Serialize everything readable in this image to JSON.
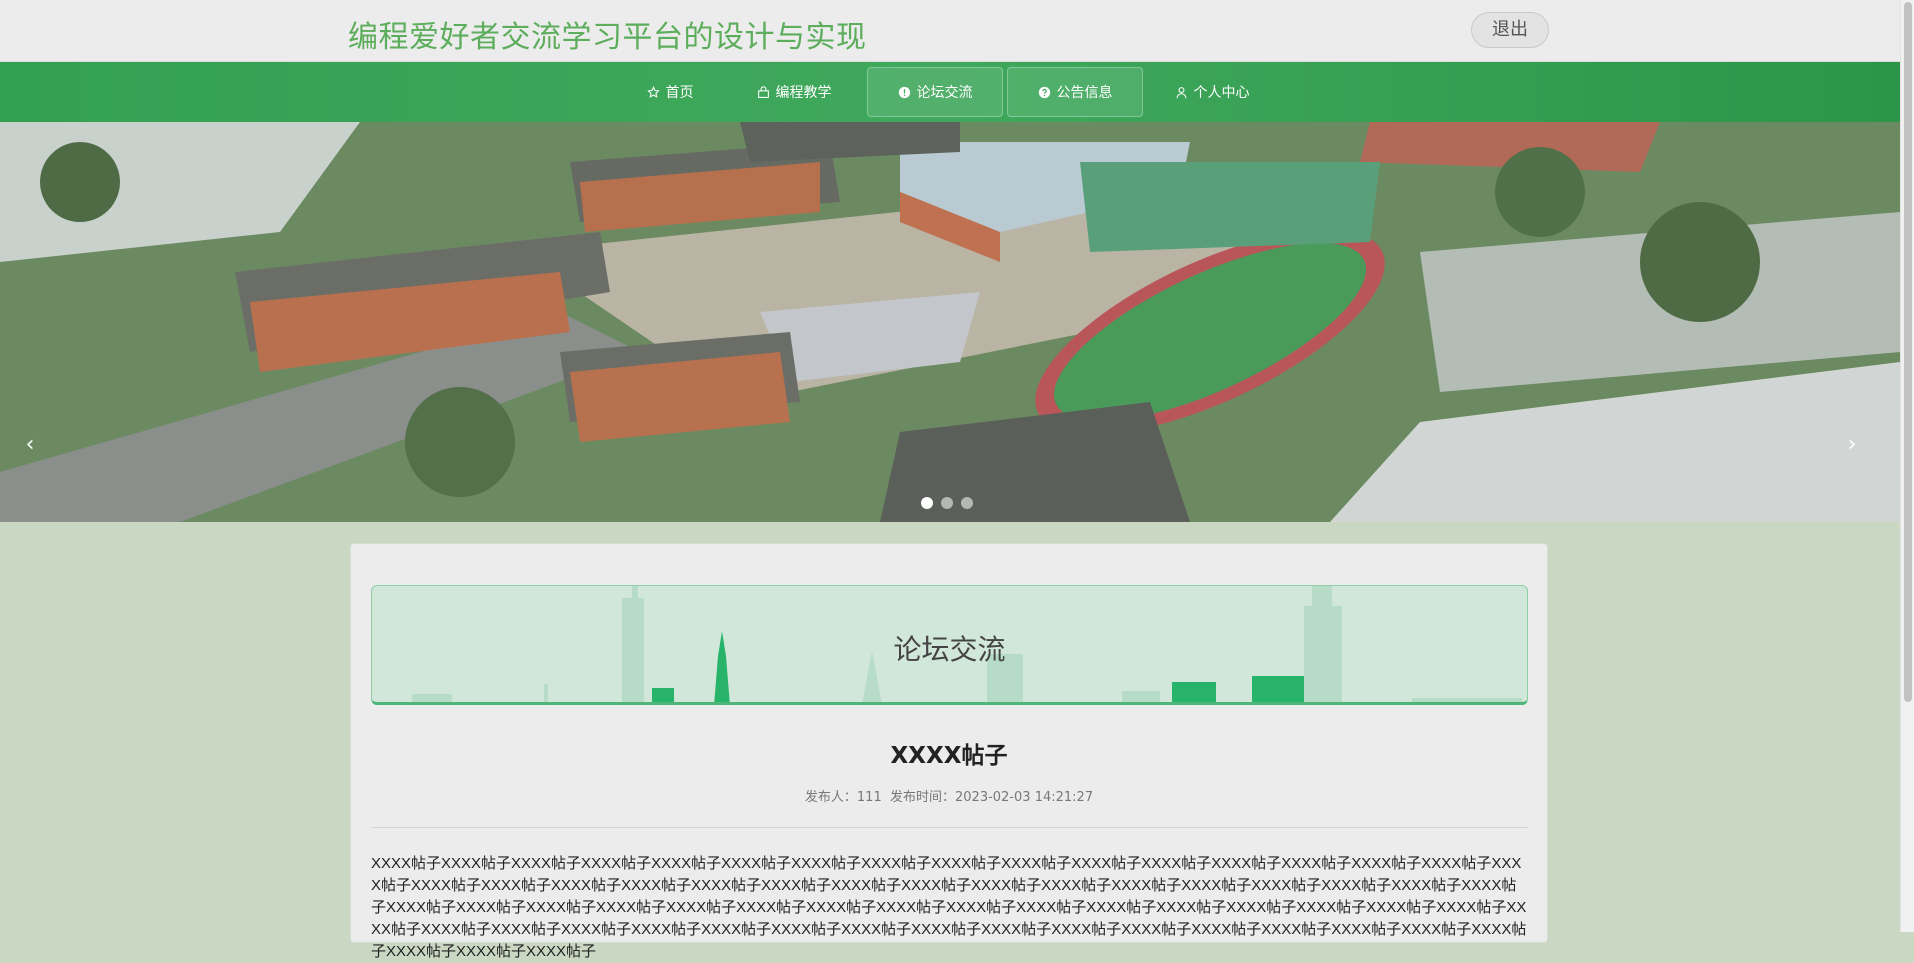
{
  "header": {
    "title": "编程爱好者交流学习平台的设计与实现",
    "logout_label": "退出"
  },
  "nav": {
    "items": [
      {
        "label": "首页",
        "icon": "star-icon"
      },
      {
        "label": "编程教学",
        "icon": "bag-icon"
      },
      {
        "label": "论坛交流",
        "icon": "info-circle-icon"
      },
      {
        "label": "公告信息",
        "icon": "help-circle-icon"
      },
      {
        "label": "个人中心",
        "icon": "user-icon"
      }
    ]
  },
  "banner": {
    "prev_arrow": "‹",
    "next_arrow": "›",
    "dots": 3,
    "active_dot": 0
  },
  "section": {
    "title": "论坛交流"
  },
  "post": {
    "title": "XXXX帖子",
    "meta_author_label": "发布人：",
    "meta_author": "111",
    "meta_time_label": "发布时间：",
    "meta_time": "2023-02-03 14:21:27",
    "body": "XXXX帖子XXXX帖子XXXX帖子XXXX帖子XXXX帖子XXXX帖子XXXX帖子XXXX帖子XXXX帖子XXXX帖子XXXX帖子XXXX帖子XXXX帖子XXXX帖子XXXX帖子XXXX帖子XXXX帖子XXXX帖子XXXX帖子XXXX帖子XXXX帖子XXXX帖子XXXX帖子XXXX帖子XXXX帖子XXXX帖子XXXX帖子XXXX帖子XXXX帖子XXXX帖子XXXX帖子XXXX帖子XXXX帖子XXXX帖子XXXX帖子XXXX帖子XXXX帖子XXXX帖子XXXX帖子XXXX帖子XXXX帖子XXXX帖子XXXX帖子XXXX帖子XXXX帖子XXXX帖子XXXX帖子XXXX帖子XXXX帖子XXXX帖子XXXX帖子XXXX帖子XXXX帖子XXXX帖子XXXX帖子XXXX帖子XXXX帖子XXXX帖子XXXX帖子XXXX帖子XXXX帖子XXXX帖子XXXX帖子XXXX帖子XXXX帖子XXXX帖子XXXX帖子XXXX帖子XXXX帖子"
  },
  "colors": {
    "title_green": "#5cad5c",
    "nav_green": "#3fa85c",
    "page_bg": "#c9d7c3",
    "section_bg": "#d0e7d9",
    "section_border": "#4db678"
  }
}
